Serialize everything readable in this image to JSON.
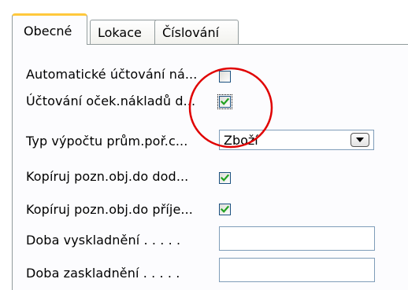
{
  "tabs": [
    {
      "label": "Obecné",
      "active": true
    },
    {
      "label": "Lokace",
      "active": false
    },
    {
      "label": "Číslování",
      "active": false
    }
  ],
  "fields": {
    "auto_posting": {
      "label": "Automatické účtování ná...",
      "checked": false
    },
    "expected_cost_posting": {
      "label": "Účtování oček.nákladů d...",
      "checked": true
    },
    "avg_cost_calc_type": {
      "label": "Typ výpočtu prům.poř.c...",
      "value": "Zboží"
    },
    "copy_comments_to_invoice": {
      "label": "Kopíruj pozn.obj.do dod...",
      "checked": true
    },
    "copy_comments_to_receipt": {
      "label": "Kopíruj pozn.obj.do příje...",
      "checked": true
    },
    "outbound_whse_handling_time": {
      "label": "Doba vyskladnění . . . . .",
      "value": ""
    },
    "inbound_whse_handling_time": {
      "label": "Doba zaskladnění . . . . .",
      "value": ""
    }
  },
  "colors": {
    "accent_tab": "#ffc83c",
    "check_green": "#21a121",
    "annotation_circle": "#e00000"
  },
  "icons": {
    "dropdown": "dropdown-arrow-icon",
    "check": "check-mark-icon"
  }
}
